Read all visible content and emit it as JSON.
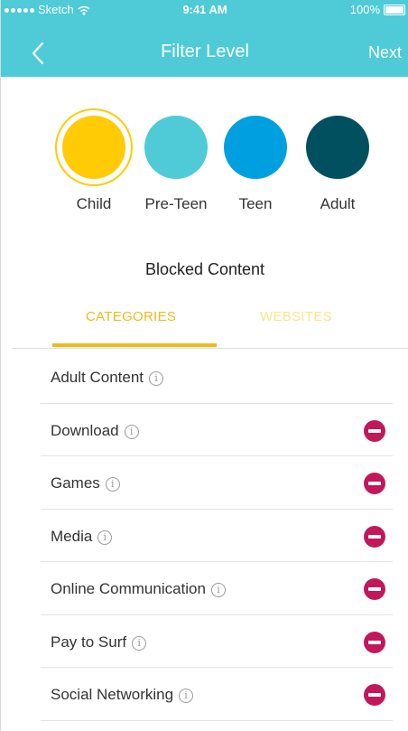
{
  "status_bar": {
    "carrier": "Sketch",
    "time": "9:41 AM",
    "battery": "100%"
  },
  "nav": {
    "title": "Filter Level",
    "next_label": "Next"
  },
  "levels": [
    {
      "label": "Child",
      "color": "#ffcb05",
      "selected": true
    },
    {
      "label": "Pre-Teen",
      "color": "#4ecbd6",
      "selected": false
    },
    {
      "label": "Teen",
      "color": "#00a0e0",
      "selected": false
    },
    {
      "label": "Adult",
      "color": "#00505f",
      "selected": false
    }
  ],
  "blocked": {
    "title": "Blocked Content",
    "tabs": [
      {
        "label": "CATEGORIES",
        "active": true
      },
      {
        "label": "WEBSITES",
        "active": false
      }
    ],
    "items": [
      {
        "label": "Adult Content",
        "info_icon": "i",
        "removable": false
      },
      {
        "label": "Download",
        "info_icon": "i",
        "removable": true
      },
      {
        "label": "Games",
        "info_icon": "i",
        "removable": true
      },
      {
        "label": "Media",
        "info_icon": "i",
        "removable": true
      },
      {
        "label": "Online Communication",
        "info_icon": "i",
        "removable": true
      },
      {
        "label": "Pay to Surf",
        "info_icon": "i",
        "removable": true
      },
      {
        "label": "Social Networking",
        "info_icon": "i",
        "removable": true
      }
    ]
  },
  "colors": {
    "header": "#4ecbd6",
    "accent": "#f3b91b",
    "remove": "#c2185b"
  }
}
